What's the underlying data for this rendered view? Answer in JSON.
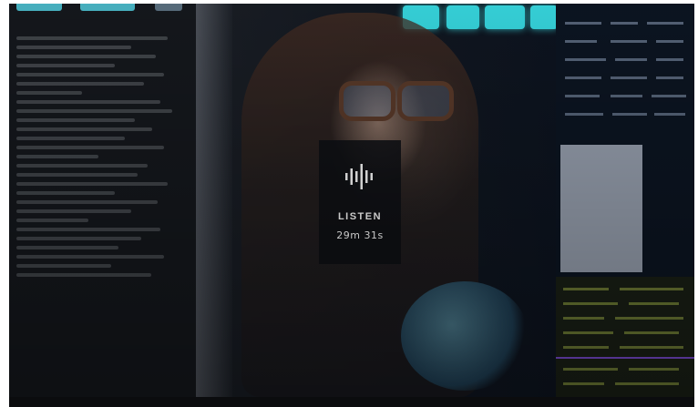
{
  "hero": {
    "image_icon": "woman-looking-at-data-screens-image",
    "listen_card": {
      "icon": "audio-waveform-icon",
      "label": "LISTEN",
      "duration": "29m 31s"
    }
  },
  "colors": {
    "card_background": "#0e1014",
    "card_text": "#ffffff",
    "accent_cyan": "#37d8e0"
  }
}
